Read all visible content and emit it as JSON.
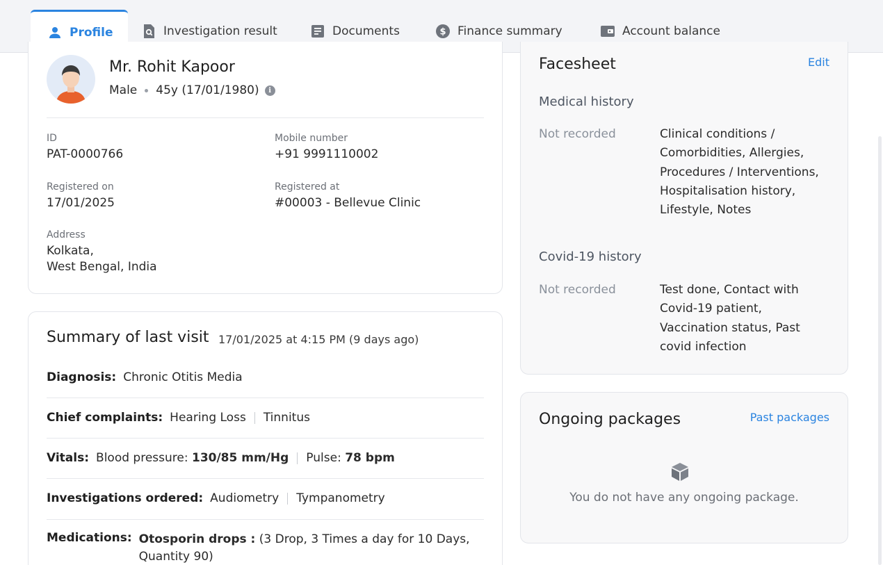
{
  "tabs": [
    {
      "label": "Profile",
      "icon": "person-icon",
      "active": true
    },
    {
      "label": "Investigation result",
      "icon": "file-search-icon",
      "active": false
    },
    {
      "label": "Documents",
      "icon": "document-icon",
      "active": false
    },
    {
      "label": "Finance summary",
      "icon": "dollar-circle-icon",
      "active": false
    },
    {
      "label": "Account balance",
      "icon": "wallet-icon",
      "active": false
    }
  ],
  "patient": {
    "name": "Mr. Rohit Kapoor",
    "gender": "Male",
    "age": "45y (17/01/1980)",
    "id_label": "ID",
    "id": "PAT-0000766",
    "mobile_label": "Mobile number",
    "mobile": "+91 9991110002",
    "registered_on_label": "Registered on",
    "registered_on": "17/01/2025",
    "registered_at_label": "Registered at",
    "registered_at": "#00003 - Bellevue Clinic",
    "address_label": "Address",
    "address_line1": "Kolkata,",
    "address_line2": "West Bengal, India"
  },
  "visit": {
    "title": "Summary of last visit",
    "when": "17/01/2025 at 4:15 PM (9 days ago)",
    "diagnosis_label": "Diagnosis:",
    "diagnosis": "Chronic Otitis Media",
    "complaints_label": "Chief complaints:",
    "complaints": [
      "Hearing Loss",
      "Tinnitus"
    ],
    "vitals_label": "Vitals:",
    "bp_label": "Blood pressure:",
    "bp_value": "130/85 mm/Hg",
    "pulse_label": "Pulse:",
    "pulse_value": "78 bpm",
    "investigations_label": "Investigations ordered:",
    "investigations": [
      "Audiometry",
      "Tympanometry"
    ],
    "medications_label": "Medications:",
    "medication_name": "Otosporin drops :",
    "medication_detail_1": "(3 Drop, 3 Times a day for 10 Days,",
    "medication_detail_2": "Quantity 90)"
  },
  "facesheet": {
    "title": "Facesheet",
    "edit_label": "Edit",
    "medical_history_heading": "Medical history",
    "medical_status": "Not recorded",
    "medical_desc": "Clinical conditions / Comorbidities, Allergies, Procedures / Interventions, Hospitalisation history, Lifestyle, Notes",
    "covid_heading": "Covid-19 history",
    "covid_status": "Not recorded",
    "covid_desc": "Test done, Contact with Covid-19 patient, Vaccination status, Past covid infection"
  },
  "packages": {
    "title": "Ongoing packages",
    "past_label": "Past packages",
    "empty_text": "You do not have any ongoing package."
  },
  "colors": {
    "accent": "#2b84e0",
    "tabbar_bg": "#f3f4f7",
    "card_grey": "#f8f8f9"
  }
}
